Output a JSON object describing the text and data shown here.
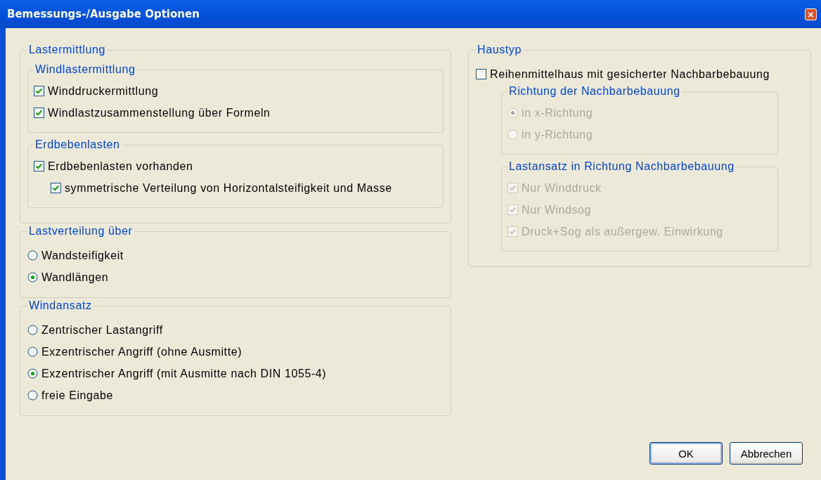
{
  "window": {
    "title": "Bemessungs-/Ausgabe Optionen",
    "close_button": "×"
  },
  "left_groups": [
    {
      "title": "Lastermittlung",
      "items": [
        {
          "kind": "group",
          "title": "Windlastermittlung",
          "items": [
            {
              "kind": "checkbox",
              "label": "Winddruckermittlung",
              "checked": true,
              "disabled": false
            },
            {
              "kind": "checkbox",
              "label": "Windlastzusammenstellung über Formeln",
              "checked": true,
              "disabled": false
            }
          ]
        },
        {
          "kind": "group",
          "title": "Erdbebenlasten",
          "items": [
            {
              "kind": "checkbox",
              "label": "Erdbebenlasten vorhanden",
              "checked": true,
              "disabled": false,
              "children": [
                {
                  "kind": "checkbox",
                  "label": "symmetrische Verteilung von Horizontalsteifigkeit und Masse",
                  "checked": true,
                  "disabled": false
                }
              ]
            }
          ]
        }
      ]
    },
    {
      "title": "Lastverteilung über",
      "items": [
        {
          "kind": "radio",
          "label": "Wandsteifigkeit",
          "selected": false,
          "disabled": false
        },
        {
          "kind": "radio",
          "label": "Wandlängen",
          "selected": true,
          "disabled": false
        }
      ]
    },
    {
      "title": "Windansatz",
      "items": [
        {
          "kind": "radio",
          "label": "Zentrischer Lastangriff",
          "selected": false,
          "disabled": false
        },
        {
          "kind": "radio",
          "label": "Exzentrischer Angriff (ohne Ausmitte)",
          "selected": false,
          "disabled": false
        },
        {
          "kind": "radio",
          "label": "Exzentrischer Angriff (mit Ausmitte nach DIN 1055-4)",
          "selected": true,
          "disabled": false
        },
        {
          "kind": "radio",
          "label": "freie Eingabe",
          "selected": false,
          "disabled": false
        }
      ]
    }
  ],
  "right_groups": [
    {
      "title": "Haustyp",
      "items": [
        {
          "kind": "checkbox",
          "label": "Reihenmittelhaus mit gesicherter Nachbarbebauung",
          "checked": false,
          "disabled": false
        },
        {
          "kind": "group",
          "title": "Richtung der Nachbarbebauung",
          "indent": true,
          "items": [
            {
              "kind": "radio",
              "label": "in x-Richtung",
              "selected": true,
              "disabled": true
            },
            {
              "kind": "radio",
              "label": "in y-Richtung",
              "selected": false,
              "disabled": true
            }
          ]
        },
        {
          "kind": "group",
          "title": "Lastansatz in Richtung Nachbarbebauung",
          "indent": true,
          "items": [
            {
              "kind": "checkbox",
              "label": "Nur Winddruck",
              "checked": true,
              "disabled": true
            },
            {
              "kind": "checkbox",
              "label": "Nur Windsog",
              "checked": true,
              "disabled": true
            },
            {
              "kind": "checkbox",
              "label": "Druck+Sog als außergew. Einwirkung",
              "checked": true,
              "disabled": true
            }
          ]
        }
      ]
    }
  ],
  "buttons": [
    {
      "label": "OK",
      "default": true
    },
    {
      "label": "Abbrechen",
      "default": false
    }
  ]
}
